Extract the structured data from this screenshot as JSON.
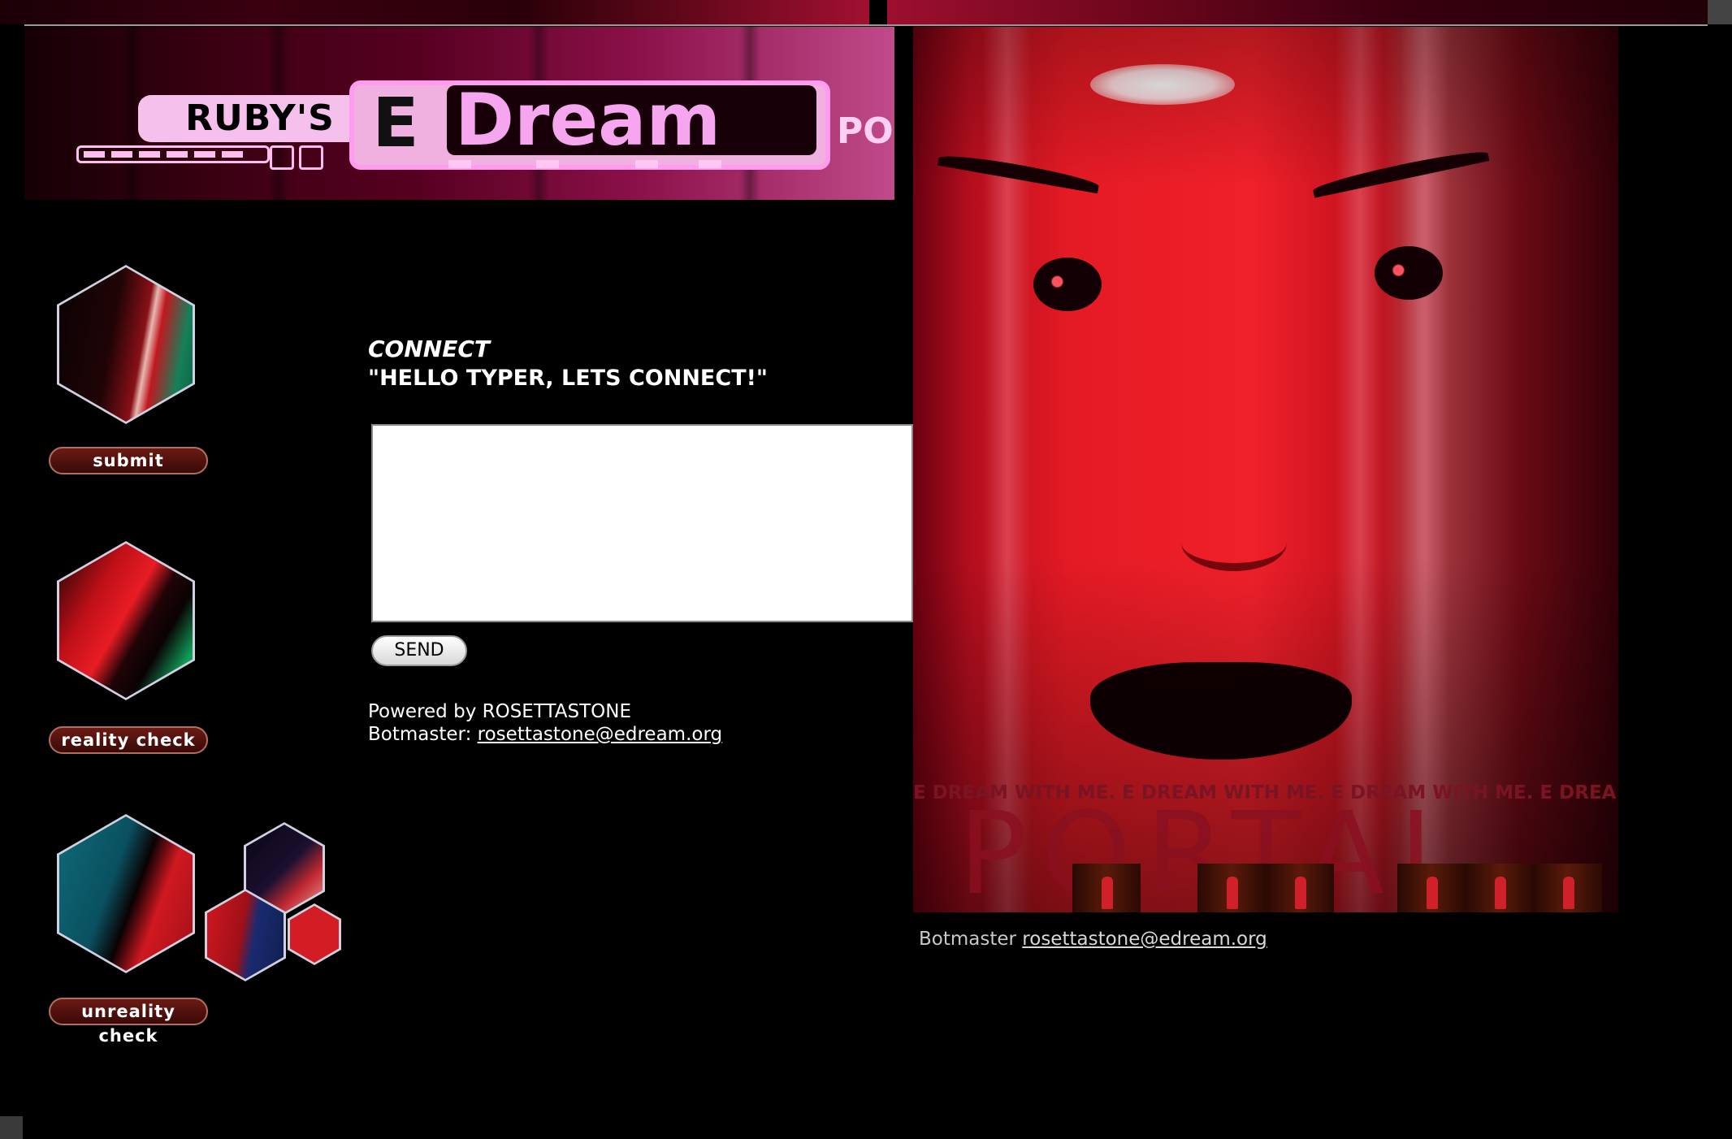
{
  "banner": {
    "rubys": "RUBY'S",
    "e_letter": "E",
    "dream": "Dream",
    "portal_fragment": "POR"
  },
  "nav": {
    "submit": "submit",
    "reality_check": "reality check",
    "unreality_check": "unreality check"
  },
  "chat": {
    "title": "CONNECT",
    "greeting": "\"HELLO TYPER, LETS CONNECT!\"",
    "input_value": "",
    "send_label": "SEND",
    "powered_label": "Powered by",
    "powered_name": "ROSETTASTONE",
    "botmaster_label": "Botmaster:",
    "botmaster_email": "rosettastone@edream.org"
  },
  "poster": {
    "tagline": "E DREAM WITH ME. E DREAM WITH ME. E DREAM WITH ME. E DREA",
    "portal": "PORTAL"
  },
  "footer": {
    "botmaster_label": "Botmaster",
    "botmaster_email": "rosettastone@edream.org"
  },
  "colors": {
    "background": "#000000",
    "accent_pink": "#f5a6ee",
    "accent_red": "#e41a24",
    "pill_brown": "#4a0e0a"
  }
}
